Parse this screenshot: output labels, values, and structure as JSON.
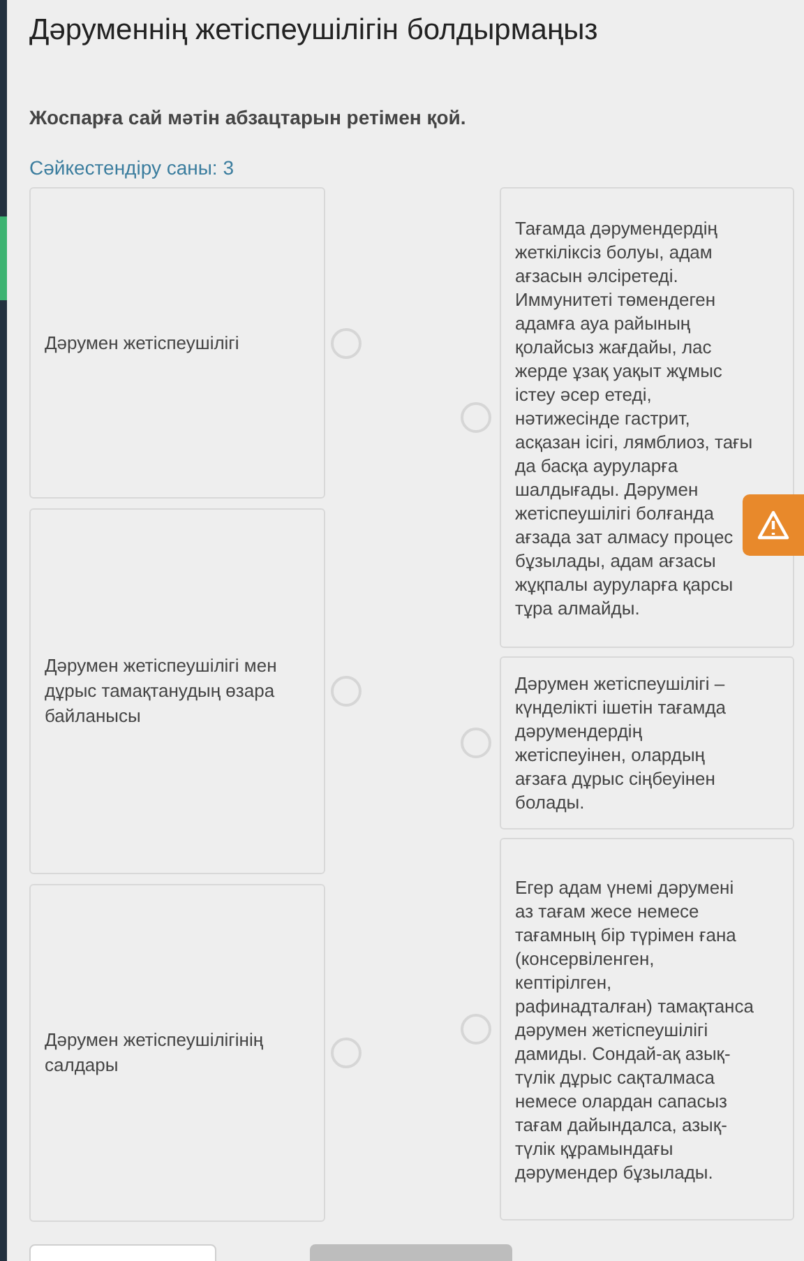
{
  "title": "Дәруменнің жетіспеушілігін болдырмаңыз",
  "instruction": "Жоспарға сай мәтін абзацтарын ретімен қой.",
  "match_count": "Сәйкестендіру саны: 3",
  "left_items": [
    {
      "text": "Дәрумен жетіспеушілігі"
    },
    {
      "text": "Дәрумен жетіспеушілігі мен дұрыс тамақтанудың өзара байланысы"
    },
    {
      "text": "Дәрумен жетіспеушілігінің салдары"
    }
  ],
  "right_items": [
    {
      "text": "Тағамда дәрумендердің жеткіліксіз болуы, адам ағзасын әлсіретеді. Иммунитеті төмендеген адамға ауа райының қолайсыз жағдайы, лас жерде ұзақ уақыт жұмыс істеу әсер етеді, нәтижесінде гастрит, асқазан ісігі, лямблиоз, тағы да басқа ауруларға шалдығады. Дәрумен жетіспеушілігі болғанда ағзада зат алмасу процес бұзылады, адам ағзасы жұқпалы ауруларға қарсы тұра алмайды."
    },
    {
      "text": "Дәрумен жетіспеушілігі – күнделікті ішетін тағамда дәрумендердің жетіспеуінен, олардың ағзаға дұрыс сіңбеуінен болады."
    },
    {
      "text": "Егер адам үнемі дәрумені аз тағам жесе немесе тағамның бір түрімен ғана (консервіленген, кептірілген, рафинадталған) тамақтанса дәрумен жетіспеушілігі дамиды. Сондай-ақ азық-түлік дұрыс сақталмаса немесе олардан сапасыз тағам дайындалса, азық-түлік құрамындағы дәрумендер бұзылады."
    }
  ]
}
